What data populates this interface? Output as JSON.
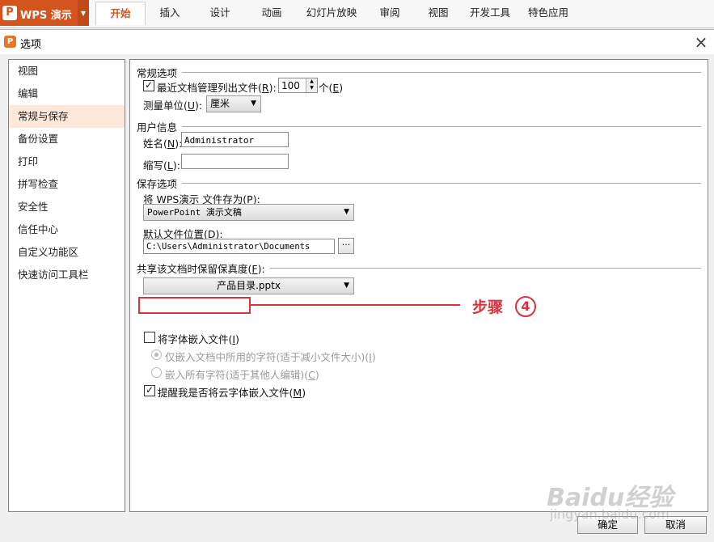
{
  "ribbon": {
    "app_name": "WPS 演示",
    "tabs": [
      "开始",
      "插入",
      "设计",
      "动画",
      "幻灯片放映",
      "审阅",
      "视图",
      "开发工具",
      "特色应用"
    ],
    "active_tab": "开始"
  },
  "dialog": {
    "title": "选项",
    "close_label": "×",
    "ok_label": "确定",
    "cancel_label": "取消"
  },
  "nav": {
    "items": [
      "视图",
      "编辑",
      "常规与保存",
      "备份设置",
      "打印",
      "拼写检查",
      "安全性",
      "信任中心",
      "自定义功能区",
      "快速访问工具栏"
    ],
    "selected": "常规与保存"
  },
  "general": {
    "section_title": "常规选项",
    "recent_label_pre": "最近文档管理列出文件(",
    "recent_key": "R",
    "recent_label_post": "):",
    "recent_checked": true,
    "recent_value": "100",
    "recent_unit_pre": "个(",
    "recent_unit_key": "E",
    "recent_unit_post": ")",
    "unit_label_pre": "测量单位(",
    "unit_key": "U",
    "unit_label_post": "):",
    "unit_value": "厘米"
  },
  "user": {
    "section_title": "用户信息",
    "name_label_pre": "姓名(",
    "name_key": "N",
    "name_label_post": "):",
    "name_value": "Administrator",
    "initials_label_pre": "缩写(",
    "initials_key": "L",
    "initials_label_post": "):",
    "initials_value": ""
  },
  "save": {
    "section_title": "保存选项",
    "format_label_pre": "将 WPS演示 文件存为(",
    "format_key": "P",
    "format_label_post": "):",
    "format_value": "PowerPoint 演示文稿",
    "location_label_pre": "默认文件位置(",
    "location_key": "D",
    "location_label_post": "):",
    "location_value": "C:\\Users\\Administrator\\Documents",
    "browse_label": "···"
  },
  "fidelity": {
    "section_label_pre": "共享该文档时保留保真度(",
    "section_key": "F",
    "section_label_post": "):",
    "document_value": "产品目录.pptx",
    "embed_label_pre": "将字体嵌入文件(",
    "embed_key": "I",
    "embed_label_post": ")",
    "embed_checked": false,
    "only_used_label_pre": "仅嵌入文档中所用的字符(适于减小文件大小)(",
    "only_used_key": "I",
    "only_used_label_post": ")",
    "all_chars_label_pre": "嵌入所有字符(适于其他人编辑)(",
    "all_chars_key": "C",
    "all_chars_label_post": ")",
    "remind_label_pre": "提醒我是否将云字体嵌入文件(",
    "remind_key": "M",
    "remind_label_post": ")",
    "remind_checked": true
  },
  "annotation": {
    "step_text": "步骤",
    "step_number": "4",
    "color": "#d8343f"
  },
  "watermark": {
    "text": "Baidu经验",
    "sub": "jingyan.baidu.com"
  },
  "icons": {
    "check": "✓",
    "dropdown": "▼",
    "spin_up": "▲",
    "spin_down": "▼",
    "close": "×"
  }
}
